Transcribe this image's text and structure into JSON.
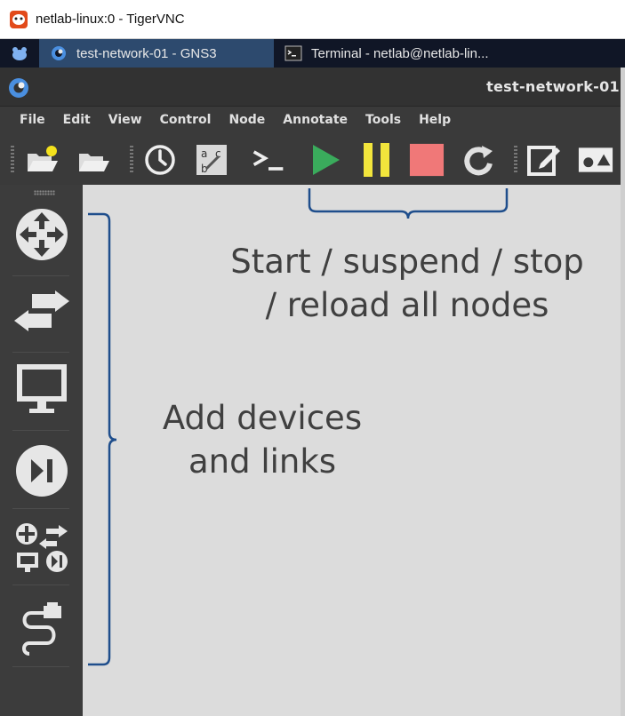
{
  "vnc_window": {
    "title": "netlab-linux:0 - TigerVNC"
  },
  "taskbar": {
    "tasks": [
      {
        "label": "test-network-01 - GNS3",
        "active": true
      },
      {
        "label": "Terminal - netlab@netlab-lin...",
        "active": false
      }
    ]
  },
  "gns3": {
    "window_title": "test-network-01",
    "menu": [
      "File",
      "Edit",
      "View",
      "Control",
      "Node",
      "Annotate",
      "Tools",
      "Help"
    ],
    "toolbar_icons": [
      "new-project-icon",
      "open-project-icon",
      "snapshot-icon",
      "show-interface-labels-icon",
      "console-all-icon",
      "start-all-icon",
      "suspend-all-icon",
      "stop-all-icon",
      "reload-all-icon",
      "add-note-icon",
      "insert-image-icon"
    ],
    "device_panel_icons": [
      "router-icon",
      "switch-icon",
      "end-device-icon",
      "security-device-icon",
      "all-devices-icon",
      "add-link-icon"
    ]
  },
  "annotations": {
    "top_line1": "Start / suspend / stop",
    "top_line2": "/ reload all nodes",
    "left_line1": "Add devices",
    "left_line2": "and links"
  },
  "colors": {
    "start": "#3aab5c",
    "suspend": "#f2e53c",
    "stop": "#f07878",
    "bracket": "#1f4e8c"
  }
}
